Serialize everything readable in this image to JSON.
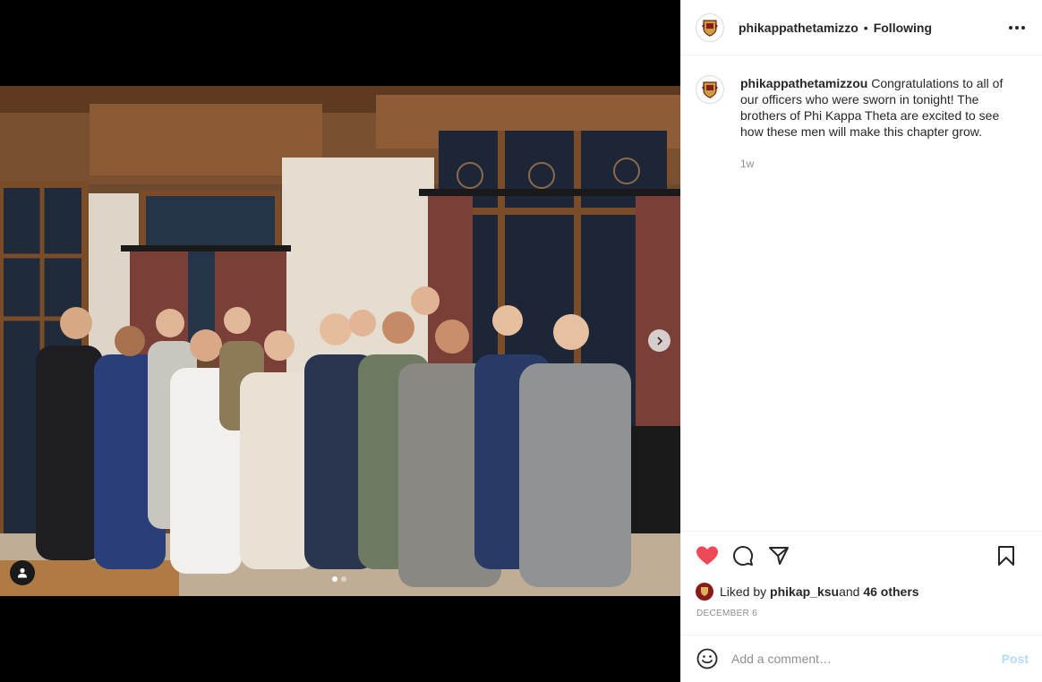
{
  "post": {
    "author": "phikappathetamizzo",
    "separator": "•",
    "follow_status": "Following",
    "carousel": {
      "current": 1,
      "total": 2
    }
  },
  "caption": {
    "author": "phikappathetamizzou",
    "text": " Congratulations to all of our officers who were sworn in tonight! The brothers of Phi Kappa Theta are excited to see how these men will make this chapter grow.",
    "time": "1w"
  },
  "likes": {
    "prefix": "Liked by ",
    "user": "phikap_ksu",
    "middle": " and ",
    "others": "46 others"
  },
  "date": "DECEMBER 6",
  "comment": {
    "placeholder": "Add a comment…",
    "post_label": "Post"
  },
  "colors": {
    "like_red": "#ed4956",
    "post_disabled_blue": "#b3dbff",
    "muted_text": "#8e8e8e"
  },
  "icons": [
    "heart-icon",
    "comment-icon",
    "share-icon",
    "bookmark-icon",
    "emoji-icon",
    "more-icon",
    "chevron-right-icon",
    "user-tag-icon"
  ]
}
